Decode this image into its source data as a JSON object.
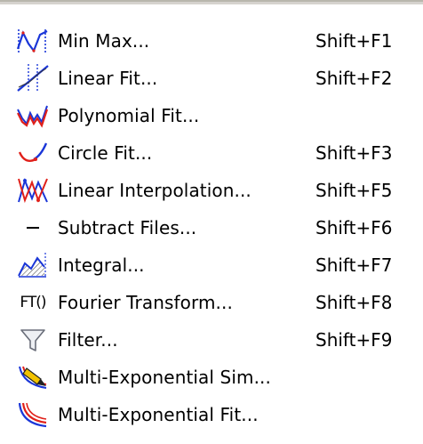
{
  "menu": {
    "items": [
      {
        "label": "Min Max...",
        "shortcut": "Shift+F1",
        "icon": "min-max-icon"
      },
      {
        "label": "Linear Fit...",
        "shortcut": "Shift+F2",
        "icon": "linear-fit-icon"
      },
      {
        "label": "Polynomial Fit...",
        "shortcut": "",
        "icon": "polynomial-fit-icon"
      },
      {
        "label": "Circle Fit...",
        "shortcut": "Shift+F3",
        "icon": "circle-fit-icon"
      },
      {
        "label": "Linear Interpolation...",
        "shortcut": "Shift+F5",
        "icon": "linear-interpolation-icon"
      },
      {
        "label": "Subtract Files...",
        "shortcut": "Shift+F6",
        "icon": "subtract-icon"
      },
      {
        "label": "Integral...",
        "shortcut": "Shift+F7",
        "icon": "integral-icon"
      },
      {
        "label": "Fourier Transform...",
        "shortcut": "Shift+F8",
        "icon": "fourier-transform-icon",
        "icon_text": "FT()"
      },
      {
        "label": "Filter...",
        "shortcut": "Shift+F9",
        "icon": "filter-icon"
      },
      {
        "label": "Multi-Exponential Sim...",
        "shortcut": "",
        "icon": "multi-exponential-sim-icon"
      },
      {
        "label": "Multi-Exponential Fit...",
        "shortcut": "",
        "icon": "multi-exponential-fit-icon"
      }
    ]
  },
  "colors": {
    "menu_background": "#ffffff",
    "border": "#b9b7ad",
    "icon_blue": "#1a36d8",
    "icon_red": "#e0201a"
  }
}
